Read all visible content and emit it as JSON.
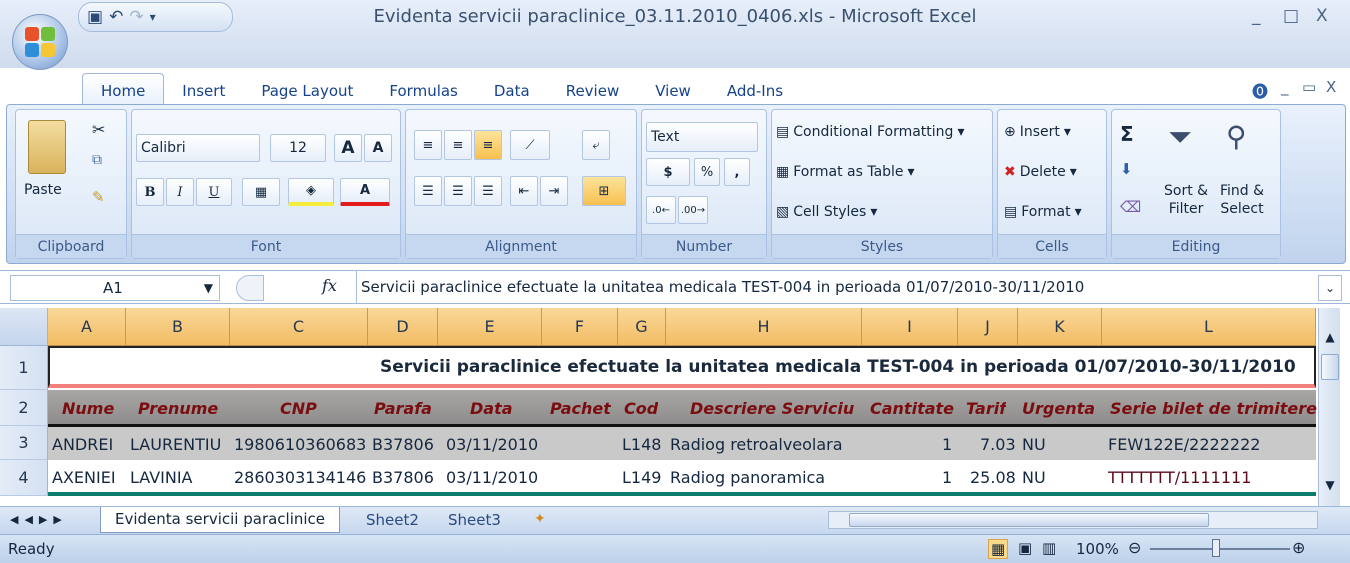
{
  "window": {
    "title": "Evidenta servicii paraclinice_03.11.2010_0406.xls - Microsoft Excel"
  },
  "ribbon_tabs": [
    "Home",
    "Insert",
    "Page Layout",
    "Formulas",
    "Data",
    "Review",
    "View",
    "Add-Ins"
  ],
  "clipboard": {
    "paste": "Paste",
    "label": "Clipboard"
  },
  "font": {
    "name": "Calibri",
    "size": "12",
    "label": "Font",
    "bold": "B",
    "italic": "I",
    "underline": "U"
  },
  "alignment": {
    "label": "Alignment"
  },
  "number": {
    "format": "Text",
    "label": "Number",
    "currency": "$",
    "percent": "%",
    "comma": ","
  },
  "styles": {
    "cond": "Conditional Formatting",
    "table": "Format as Table",
    "cell": "Cell Styles",
    "label": "Styles"
  },
  "cells": {
    "insert": "Insert",
    "delete": "Delete",
    "format": "Format",
    "label": "Cells"
  },
  "editing": {
    "sum": "Σ",
    "sort": "Sort &",
    "sort2": "Filter",
    "find": "Find &",
    "find2": "Select",
    "label": "Editing"
  },
  "formula": {
    "cellref": "A1",
    "fx": "fx",
    "content": "Servicii paraclinice efectuate la unitatea medicala TEST-004 in perioada 01/07/2010-30/11/2010"
  },
  "columns": [
    "A",
    "B",
    "C",
    "D",
    "E",
    "F",
    "G",
    "H",
    "I",
    "J",
    "K",
    "L"
  ],
  "rows": [
    "1",
    "2",
    "3",
    "4"
  ],
  "title_row": "Servicii paraclinice efectuate la unitatea medicala TEST-004 in perioada 01/07/2010-30/11/2010",
  "headers": [
    "Nume",
    "Prenume",
    "CNP",
    "Parafa",
    "Data",
    "Pachet",
    "Cod",
    "Descriere Serviciu",
    "Cantitate",
    "Tarif",
    "Urgenta",
    "Serie bilet de trimitere"
  ],
  "data_rows": [
    [
      "ANDREI",
      "LAURENTIU",
      "1980610360683",
      "B37806",
      "03/11/2010",
      "",
      "L148",
      "Radiog retroalveolara",
      "1",
      "7.03",
      "NU",
      "FEW122E/2222222"
    ],
    [
      "AXENIEI",
      "LAVINIA",
      "2860303134146",
      "B37806",
      "03/11/2010",
      "",
      "L149",
      "Radiog panoramica",
      "1",
      "25.08",
      "NU",
      "TTTTTTT/1111111"
    ]
  ],
  "sheets": [
    "Evidenta servicii paraclinice",
    "Sheet2",
    "Sheet3"
  ],
  "status": {
    "text": "Ready",
    "zoom": "100%"
  }
}
